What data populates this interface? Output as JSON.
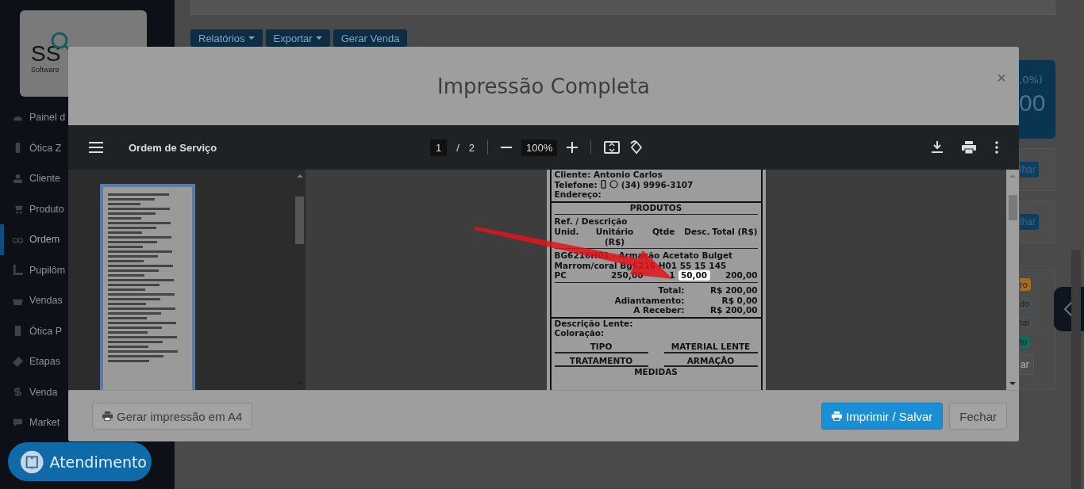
{
  "sidebar": {
    "logo": {
      "name": "SS",
      "tagline": "Software"
    },
    "items": [
      {
        "label": "Painel d",
        "selected": false
      },
      {
        "label": "Ótica Z",
        "selected": false
      },
      {
        "label": "Cliente",
        "selected": false
      },
      {
        "label": "Produto",
        "selected": false
      },
      {
        "label": "Ordem",
        "selected": true
      },
      {
        "label": "Pupilôm",
        "selected": false
      },
      {
        "label": "Vendas",
        "selected": false
      },
      {
        "label": "Ótica P",
        "selected": false
      },
      {
        "label": "Etapas",
        "selected": false
      },
      {
        "label": "Venda",
        "selected": false
      },
      {
        "label": "Market",
        "selected": false
      }
    ]
  },
  "toolbar_buttons": [
    {
      "label": "Relatórios",
      "kind": "dropdown"
    },
    {
      "label": "Exportar",
      "kind": "dropdown"
    },
    {
      "label": "Gerar Venda",
      "kind": "button"
    }
  ],
  "right_panel": {
    "stat_card": {
      "percent": ",0%)",
      "value": "00"
    },
    "detail_buttons": [
      "lhar",
      "lhar"
    ],
    "tags": [
      {
        "label": "ro",
        "color": "#a86a1e"
      },
      {
        "label": "do",
        "color": "#4a4f52"
      },
      {
        "label": "tal",
        "color": "#4a4f52"
      },
      {
        "label": "to",
        "color": "#0e6b60"
      }
    ],
    "button": "ar"
  },
  "modal": {
    "title": "Impressão Completa",
    "close": "×",
    "viewer": {
      "document_title": "Ordem de Serviço",
      "page": "1",
      "separator": "/",
      "page_count": "2",
      "zoom": "100%",
      "document": {
        "client": {
          "label": "Cliente:",
          "value": "Antonio Carlos"
        },
        "phone": {
          "label": "Telefone:",
          "value": "(34) 9996-3107"
        },
        "address": {
          "label": "Endereço:"
        },
        "products": {
          "title": "PRODUTOS",
          "ref_label": "Ref. / Descrição",
          "columns": [
            "Unid.",
            "Unitário (R$)",
            "Qtde",
            "Desc.",
            "Total (R$)"
          ],
          "items": [
            {
              "description": "BG6216H01 - Armação Acetato Bulget Marrom/coral Bg6216 H01 55 15 145",
              "unit": "PC",
              "unit_price": "250,00",
              "qty": "1",
              "discount": "50,00",
              "total": "200,00",
              "discount_highlighted": true
            }
          ]
        },
        "totals": [
          {
            "label": "Total:",
            "value": "R$ 200,00"
          },
          {
            "label": "Adiantamento:",
            "value": "R$ 0,00"
          },
          {
            "label": "A Receber:",
            "value": "R$ 200,00"
          }
        ],
        "lens": {
          "labels": [
            "Descrição Lente:",
            "Coloração:"
          ],
          "headings": [
            "TIPO",
            "MATERIAL LENTE",
            "TRATAMENTO",
            "ARMAÇÃO"
          ],
          "next_section": "MEDIDAS"
        }
      }
    },
    "footer": {
      "a4_button": "Gerar impressão em A4",
      "print_button": "Imprimir / Salvar",
      "close_button": "Fechar"
    }
  },
  "chat_button": {
    "label": "Atendimento"
  }
}
